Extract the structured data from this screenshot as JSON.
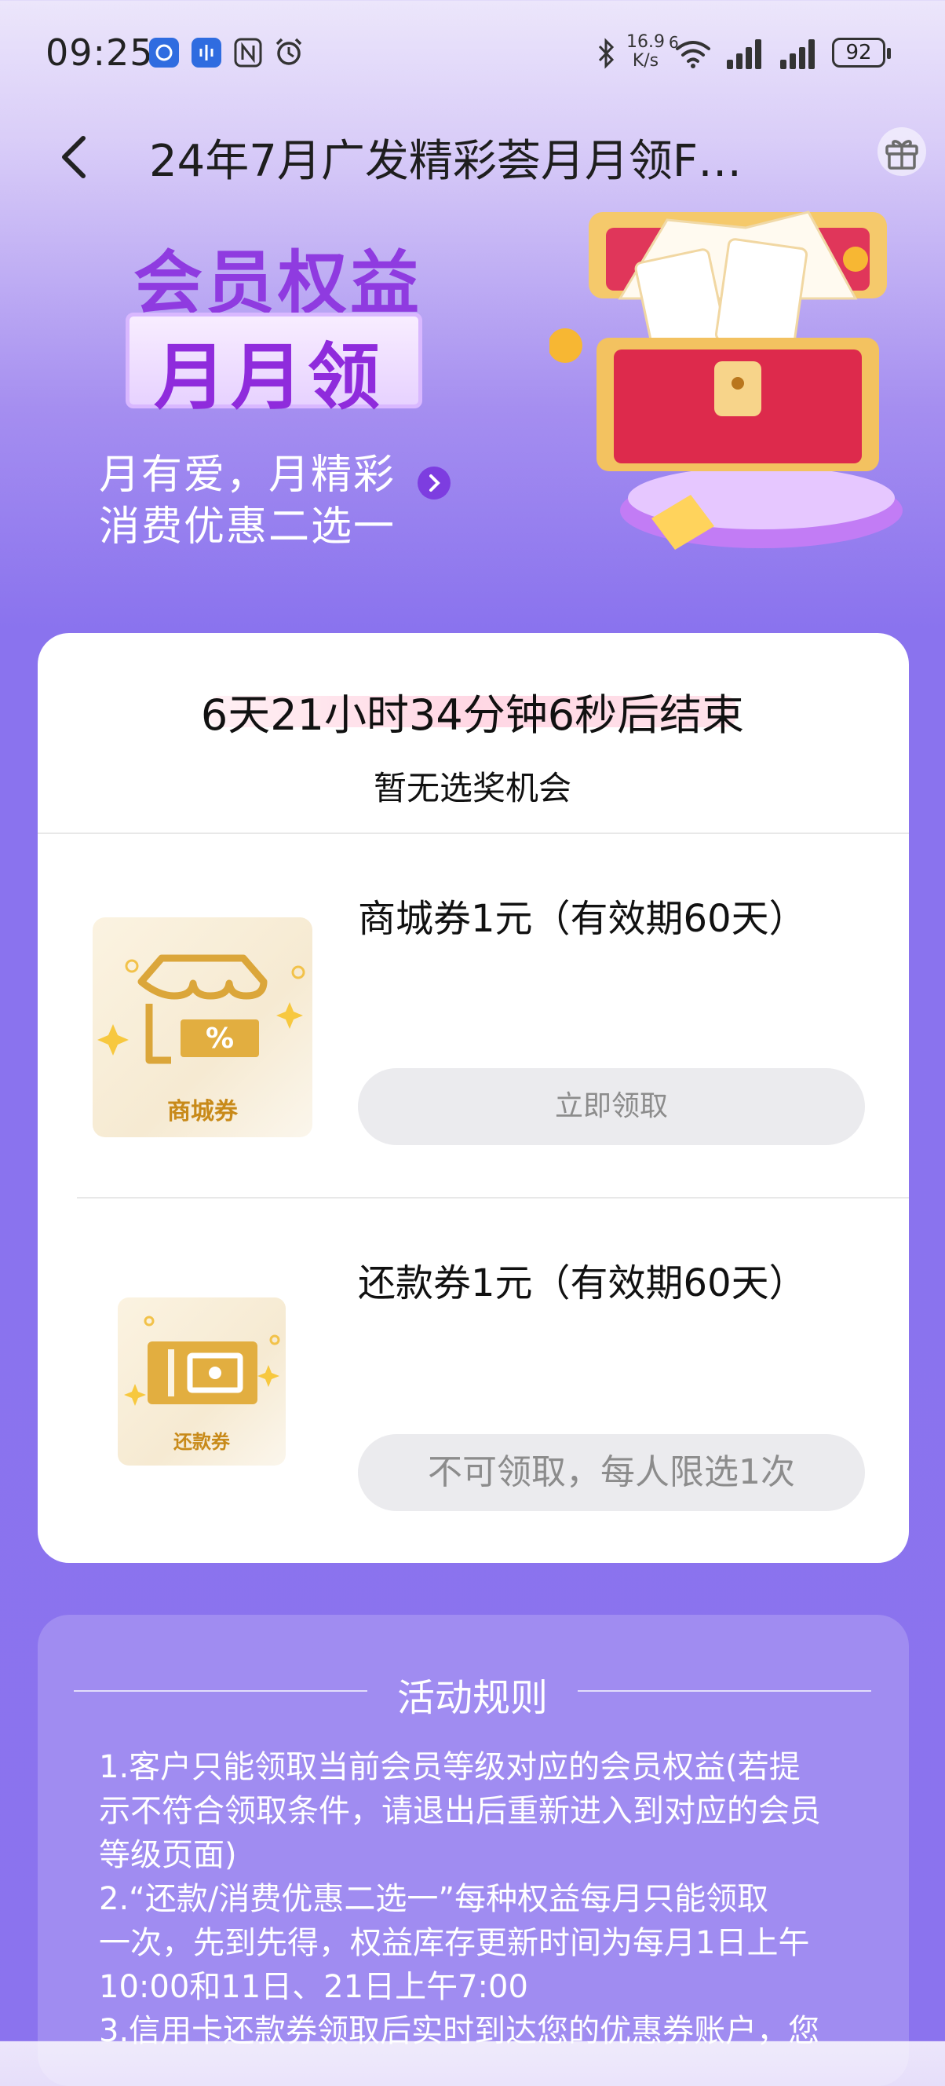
{
  "status_bar": {
    "time": "09:25",
    "net_speed_value": "16.9",
    "net_speed_unit": "K/s",
    "wifi_badge": "6",
    "battery": "92"
  },
  "header": {
    "title": "24年7月广发精彩荟月月领F…"
  },
  "banner": {
    "title": "会员权益",
    "subtitle": "月月领",
    "line1": "月有爱，月精彩",
    "line2": "消费优惠二选一"
  },
  "countdown": "6天21小时34分钟6秒后结束",
  "no_chance": "暂无选奖机会",
  "items": [
    {
      "title": "商城券1元（有效期60天）",
      "thumb_label": "商城券",
      "button": "立即领取"
    },
    {
      "title": "还款券1元（有效期60天）",
      "thumb_label": "还款券",
      "button": "不可领取，每人限选1次"
    }
  ],
  "rules": {
    "title": "活动规则",
    "lines": [
      "1.客户只能领取当前会员等级对应的会员权益(若提",
      "示不符合领取条件，请退出后重新进入到对应的会员",
      "等级页面)",
      "2.“还款/消费优惠二选一”每种权益每月只能领取",
      "一次，先到先得，权益库存更新时间为每月1日上午",
      "10:00和11日、21日上午7:00",
      "3.信用卡还款券领取后实时到达您的优惠券账户，您"
    ]
  }
}
